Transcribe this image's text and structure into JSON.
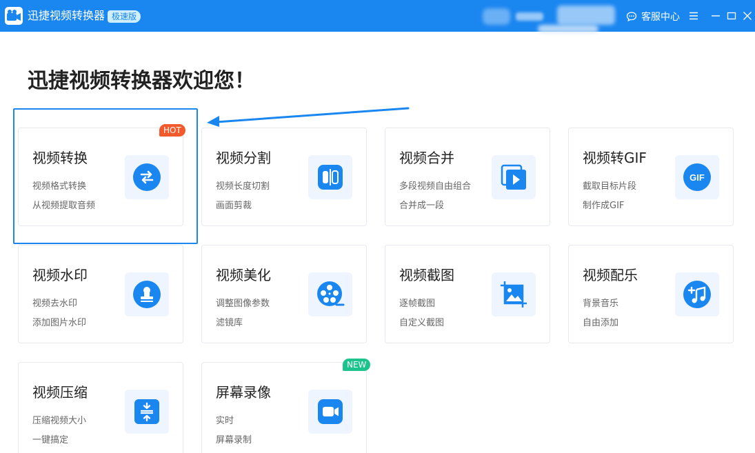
{
  "window": {
    "title": "迅捷视频转换器",
    "edition": "极速版",
    "service_label": "客服中心"
  },
  "welcome": "迅捷视频转换器欢迎您！",
  "colors": {
    "accent": "#1a86f0",
    "hot": "#f25a2b",
    "new": "#1cc48c"
  },
  "cards": [
    {
      "title": "视频转换",
      "sub1": "视频格式转换",
      "sub2": "从视频提取音频",
      "icon": "convert-arrows-icon",
      "badge": "HOT"
    },
    {
      "title": "视频分割",
      "sub1": "视频长度切割",
      "sub2": "画面剪裁",
      "icon": "split-icon"
    },
    {
      "title": "视频合并",
      "sub1": "多段视频自由组合",
      "sub2": "合并成一段",
      "icon": "merge-play-icon"
    },
    {
      "title": "视频转GIF",
      "sub1": "截取目标片段",
      "sub2": "制作成GIF",
      "icon": "gif-icon",
      "icon_text": "GIF"
    },
    {
      "title": "视频水印",
      "sub1": "视频去水印",
      "sub2": "添加图片水印",
      "icon": "stamp-icon"
    },
    {
      "title": "视频美化",
      "sub1": "调整图像参数",
      "sub2": "滤镜库",
      "icon": "film-reel-icon"
    },
    {
      "title": "视频截图",
      "sub1": "逐帧截图",
      "sub2": "自定义截图",
      "icon": "screenshot-image-icon"
    },
    {
      "title": "视频配乐",
      "sub1": "背景音乐",
      "sub2": "自由添加",
      "icon": "music-add-icon"
    },
    {
      "title": "视频压缩",
      "sub1": "压缩视频大小",
      "sub2": "一键搞定",
      "icon": "compress-icon"
    },
    {
      "title": "屏幕录像",
      "sub1": "实时",
      "sub2": "屏幕录制",
      "icon": "camera-record-icon",
      "badge": "NEW"
    }
  ]
}
